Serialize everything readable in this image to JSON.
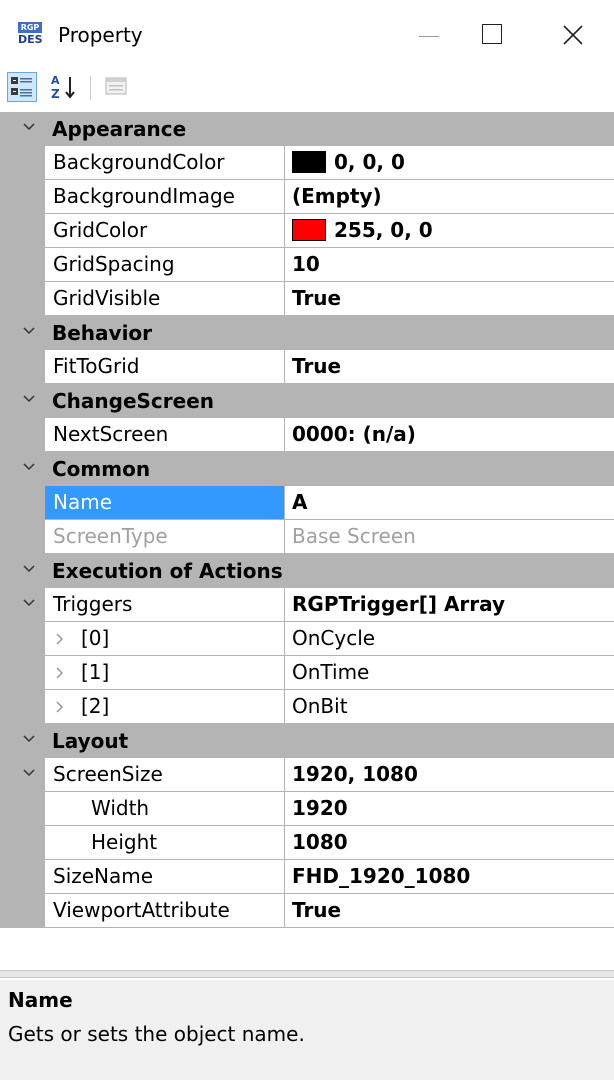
{
  "window": {
    "title": "Property",
    "icon_top": "RGP",
    "icon_bottom": "DES"
  },
  "toolbar": {
    "categorized_icon": "categorized-icon",
    "alphabetical_icon": "sort-alphabetical-icon",
    "property_pages_icon": "property-pages-icon"
  },
  "categories": {
    "appearance": "Appearance",
    "behavior": "Behavior",
    "changescreen": "ChangeScreen",
    "common": "Common",
    "execution": "Execution of Actions",
    "layout": "Layout"
  },
  "props": {
    "backgroundcolor": {
      "name": "BackgroundColor",
      "value": "0, 0, 0",
      "swatch": "#000000"
    },
    "backgroundimage": {
      "name": "BackgroundImage",
      "value": "(Empty)"
    },
    "gridcolor": {
      "name": "GridColor",
      "value": "255, 0, 0",
      "swatch": "#ff0000"
    },
    "gridspacing": {
      "name": "GridSpacing",
      "value": "10"
    },
    "gridvisible": {
      "name": "GridVisible",
      "value": "True"
    },
    "fittogrid": {
      "name": "FitToGrid",
      "value": "True"
    },
    "nextscreen": {
      "name": "NextScreen",
      "value": "0000: (n/a)"
    },
    "name": {
      "name": "Name",
      "value": "A"
    },
    "screentype": {
      "name": "ScreenType",
      "value": "Base Screen"
    },
    "triggers": {
      "name": "Triggers",
      "value": "RGPTrigger[] Array"
    },
    "trigger0": {
      "name": "[0]",
      "value": "OnCycle"
    },
    "trigger1": {
      "name": "[1]",
      "value": "OnTime"
    },
    "trigger2": {
      "name": "[2]",
      "value": "OnBit"
    },
    "screensize": {
      "name": "ScreenSize",
      "value": "1920, 1080"
    },
    "width": {
      "name": "Width",
      "value": "1920"
    },
    "height": {
      "name": "Height",
      "value": "1080"
    },
    "sizename": {
      "name": "SizeName",
      "value": "FHD_1920_1080"
    },
    "viewport": {
      "name": "ViewportAttribute",
      "value": "True"
    }
  },
  "help": {
    "title": "Name",
    "description": "Gets or sets the object name."
  },
  "colors": {
    "category_bg": "#b4b4b4",
    "selection": "#3399ff"
  }
}
